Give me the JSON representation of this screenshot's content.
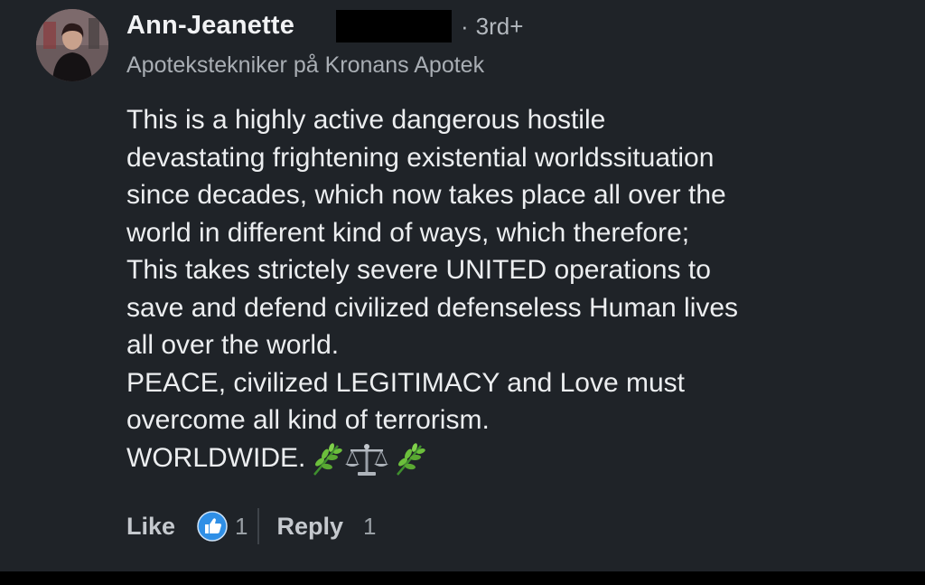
{
  "author": {
    "name": "Ann-Jeanette",
    "degree": "3rd+",
    "headline": "Apotekstekniker på Kronans Apotek"
  },
  "comment": {
    "lines": [
      "This is a highly active dangerous hostile",
      "devastating frightening existential worldssituation",
      "since decades, which now takes place all over the",
      "world in different kind of ways, which therefore;",
      "This takes strictely severe UNITED operations to",
      "save and defend civilized defenseless Human lives",
      "all over the world.",
      "PEACE, civilized LEGITIMACY and Love must",
      "overcome all kind of terrorism.",
      "WORLDWIDE."
    ],
    "emojis": [
      "herb-icon",
      "balance-scale-icon",
      "herb-icon"
    ]
  },
  "actions": {
    "like_label": "Like",
    "like_count": "1",
    "reply_label": "Reply",
    "reply_count": "1"
  },
  "colors": {
    "background": "#1f2328",
    "like_badge": "#2f8fe6"
  }
}
